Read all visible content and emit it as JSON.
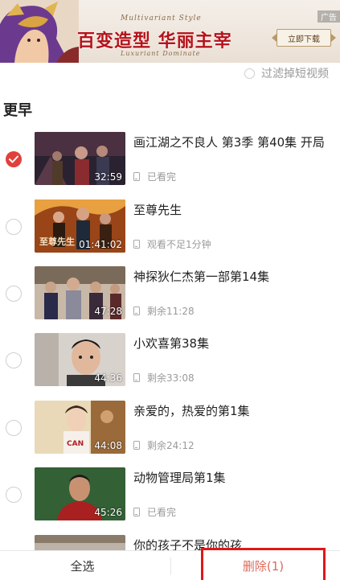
{
  "ad": {
    "tag": "广告",
    "sub_top": "Multivariant Style",
    "title": "百变造型 华丽主宰",
    "sub_bottom": "Luxuriant Dominate",
    "cta": "立即下载"
  },
  "filter": {
    "label": "过滤掉短视频"
  },
  "section": {
    "title": "更早"
  },
  "items": [
    {
      "title": "画江湖之不良人 第3季 第40集 开局",
      "duration": "32:59",
      "status": "已看完",
      "checked": true
    },
    {
      "title": "至尊先生",
      "duration": "01:41:02",
      "status": "观看不足1分钟",
      "checked": false
    },
    {
      "title": "神探狄仁杰第一部第14集",
      "duration": "47:28",
      "status": "剩余11:28",
      "checked": false
    },
    {
      "title": "小欢喜第38集",
      "duration": "44:36",
      "status": "剩余33:08",
      "checked": false
    },
    {
      "title": "亲爱的，热爱的第1集",
      "duration": "44:08",
      "status": "剩余24:12",
      "checked": false
    },
    {
      "title": "动物管理局第1集",
      "duration": "45:26",
      "status": "已看完",
      "checked": false
    },
    {
      "title": "你的孩子不是你的孩",
      "duration": "",
      "status": "",
      "checked": false
    }
  ],
  "bottom": {
    "select_all": "全选",
    "delete": "删除(1)"
  },
  "colors": {
    "accent": "#e0413a",
    "highlight_box": "#e01818"
  }
}
